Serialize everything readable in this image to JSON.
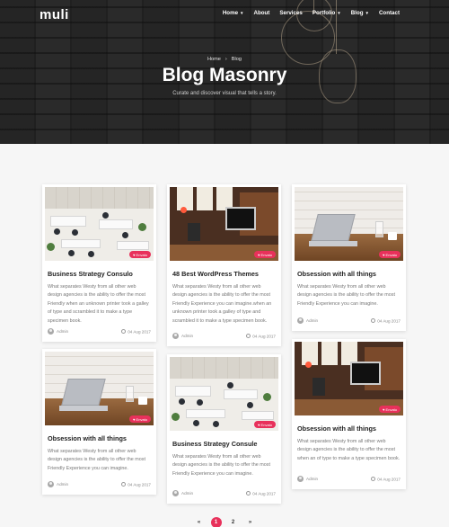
{
  "header": {
    "logo": "muli",
    "nav": [
      {
        "label": "Home",
        "dropdown": true
      },
      {
        "label": "About",
        "dropdown": false
      },
      {
        "label": "Services",
        "dropdown": false
      },
      {
        "label": "Portfolio",
        "dropdown": true
      },
      {
        "label": "Blog",
        "dropdown": true
      },
      {
        "label": "Contact",
        "dropdown": false
      }
    ]
  },
  "hero": {
    "breadcrumb": [
      "Home",
      "Blog"
    ],
    "breadcrumb_sep": "›",
    "title": "Blog Masonry",
    "subtitle": "Curate and discover visual that tells a story."
  },
  "posts": [
    {
      "title": "Business Strategy Consulo",
      "excerpt": "What separates Westy from all other web design agencies is the ability to offer the most Friendly when an unknown printer took a galley of type and scrambled it to make a type specimen book.",
      "author": "Admin",
      "date": "04 Aug 2017",
      "badge": "Envato",
      "image": "office-topdown"
    },
    {
      "title": "48 Best WordPress Themes",
      "excerpt": "What separates Westy from all other web design agencies is the ability to offer the most Friendly Experience you can imagine.when an unknown printer took a galley of type and scrambled it to make a type specimen book.",
      "author": "Admin",
      "date": "04 Aug 2017",
      "badge": "Envato",
      "image": "cafe-workspace"
    },
    {
      "title": "Obsession with all things",
      "excerpt": "What separates Westy from all other web design agencies is the ability to offer the most Friendly Experience you can imagine.",
      "author": "Admin",
      "date": "04 Aug 2017",
      "badge": "Envato",
      "image": "laptop-table"
    },
    {
      "title": "Obsession with all things",
      "excerpt": "What separates Westy from all other web design agencies is the ability to offer the most Friendly Experience you can imagine.",
      "author": "Admin",
      "date": "04 Aug 2017",
      "badge": "Envato",
      "image": "laptop-table"
    },
    {
      "title": "Business Strategy Consule",
      "excerpt": "What separates Westy from all other web design agencies is the ability to offer the most Friendly Experience you can imagine.",
      "author": "Admin",
      "date": "04 Aug 2017",
      "badge": "Envato",
      "image": "office-topdown"
    },
    {
      "title": "Obsession with all things",
      "excerpt": "What separates Westy from all other web design agencies is the ability to offer the most when an of type to make a type specimen book.",
      "author": "Admin",
      "date": "04 Aug 2017",
      "badge": "Envato",
      "image": "cafe-workspace"
    }
  ],
  "pagination": {
    "prev": "«",
    "pages": [
      "1",
      "2"
    ],
    "active": "1",
    "next": "»"
  },
  "colors": {
    "accent": "#e8315b",
    "hero_overlay": "#2d2d2d",
    "background": "#f6f6f6"
  },
  "icons": {
    "author": "user-avatar-icon",
    "date": "clock-icon",
    "badge": "heart-icon"
  }
}
